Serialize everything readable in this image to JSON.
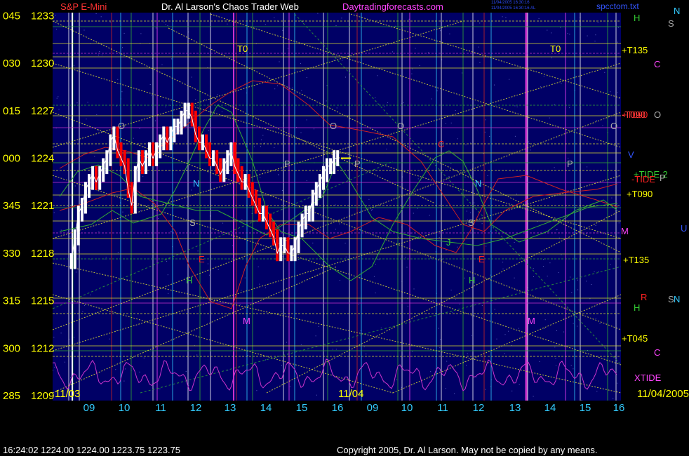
{
  "header": {
    "instrument": "S&P E-Mini",
    "title": "Dr. Al Larson's Chaos Trader Web",
    "site": "Daytradingforecasts.com",
    "stamp_lines": [
      "11/04/2005 16:30:16",
      "11/04/2005 16:30:16 AL"
    ],
    "filename": "spcctom.txt"
  },
  "footer": {
    "status": "16:24:02  1224.00 1224.00 1223.75 1223.75",
    "copyright": "Copyright 2005, Dr. Al Larson. May not be copied by any means."
  },
  "colors": {
    "background": "#000066",
    "price_up": "#ffffff",
    "price_down": "#ff0000",
    "axis_text": "#ffff00",
    "grid_yellow": "#dddd33",
    "grid_green": "#33aa33",
    "cyan": "#33ccff",
    "magenta": "#cc33cc",
    "red_line": "#cc2222"
  },
  "chart_data": {
    "type": "line",
    "title": "S&P E-Mini",
    "y_axis": {
      "min": 1209,
      "max": 1233,
      "tick_values": [
        1233,
        1230,
        1227,
        1224,
        1221,
        1218,
        1215,
        1212,
        1209
      ],
      "tick_labels": [
        "1233",
        "1230",
        "1227",
        "1224",
        "1221",
        "1218",
        "1215",
        "1212",
        "1209"
      ],
      "angle_labels": [
        "045",
        "030",
        "015",
        "000",
        "345",
        "330",
        "315",
        "300",
        "285"
      ]
    },
    "x_axis": {
      "hour_labels": [
        "09",
        "10",
        "11",
        "12",
        "13",
        "14",
        "15",
        "16",
        "09",
        "10",
        "11",
        "12",
        "13",
        "14",
        "15",
        "16"
      ],
      "date_labels": [
        "11/03",
        "11/04",
        "11/04/2005"
      ]
    },
    "price_series": {
      "name": "S&P E-Mini",
      "x_hours": [
        8.5,
        8.6,
        8.7,
        8.8,
        8.9,
        9.0,
        9.1,
        9.2,
        9.3,
        9.4,
        9.5,
        9.6,
        9.7,
        9.8,
        9.9,
        10.0,
        10.1,
        10.2,
        10.3,
        10.4,
        10.5,
        10.6,
        10.7,
        10.8,
        10.9,
        11.0,
        11.1,
        11.2,
        11.3,
        11.4,
        11.5,
        11.6,
        11.7,
        11.8,
        11.9,
        12.0,
        12.1,
        12.2,
        12.3,
        12.4,
        12.5,
        12.6,
        12.7,
        12.8,
        12.9,
        13.0,
        13.1,
        13.2,
        13.3,
        13.4,
        13.5,
        13.6,
        13.7,
        13.8,
        13.9,
        14.0,
        14.1,
        14.2,
        14.3,
        14.4,
        14.5,
        14.6,
        14.7,
        14.8,
        14.9,
        15.0,
        15.1,
        15.2,
        15.3,
        15.4,
        15.5,
        15.6,
        15.7,
        15.8,
        15.9,
        16.0
      ],
      "values": [
        1217.5,
        1219.0,
        1220.5,
        1221.0,
        1222.0,
        1222.5,
        1223.0,
        1222.5,
        1223.0,
        1223.5,
        1224.0,
        1225.0,
        1225.5,
        1224.5,
        1224.0,
        1223.5,
        1222.0,
        1221.0,
        1223.0,
        1224.0,
        1223.5,
        1224.0,
        1224.5,
        1224.0,
        1224.5,
        1225.0,
        1225.5,
        1225.0,
        1225.5,
        1226.0,
        1226.0,
        1226.5,
        1227.0,
        1227.0,
        1226.5,
        1225.5,
        1225.0,
        1225.0,
        1224.5,
        1224.0,
        1224.0,
        1223.5,
        1223.0,
        1223.5,
        1224.0,
        1224.5,
        1223.5,
        1223.0,
        1222.5,
        1222.5,
        1222.0,
        1221.5,
        1221.0,
        1220.5,
        1220.5,
        1220.0,
        1219.5,
        1219.0,
        1218.0,
        1218.5,
        1218.5,
        1218.0,
        1218.0,
        1218.5,
        1219.5,
        1220.0,
        1220.5,
        1220.5,
        1221.5,
        1222.0,
        1222.5,
        1223.0,
        1223.5,
        1223.5,
        1224.0,
        1224.0
      ]
    },
    "annotations": [
      "T0",
      "T0",
      "+T135",
      "+T090",
      "+T090",
      "+T135",
      "+T045",
      "-T090",
      "+TIDE-2",
      "-TIDE",
      "XTIDE",
      "H",
      "H",
      "H",
      "H",
      "S",
      "S",
      "S",
      "S",
      "N",
      "N",
      "N",
      "N",
      "C",
      "C",
      "C",
      "R",
      "P",
      "P",
      "P",
      "P",
      "O",
      "O",
      "O",
      "O",
      "O",
      "V",
      "M",
      "M",
      "M",
      "U",
      "E",
      "E",
      "J"
    ],
    "grid": true
  }
}
